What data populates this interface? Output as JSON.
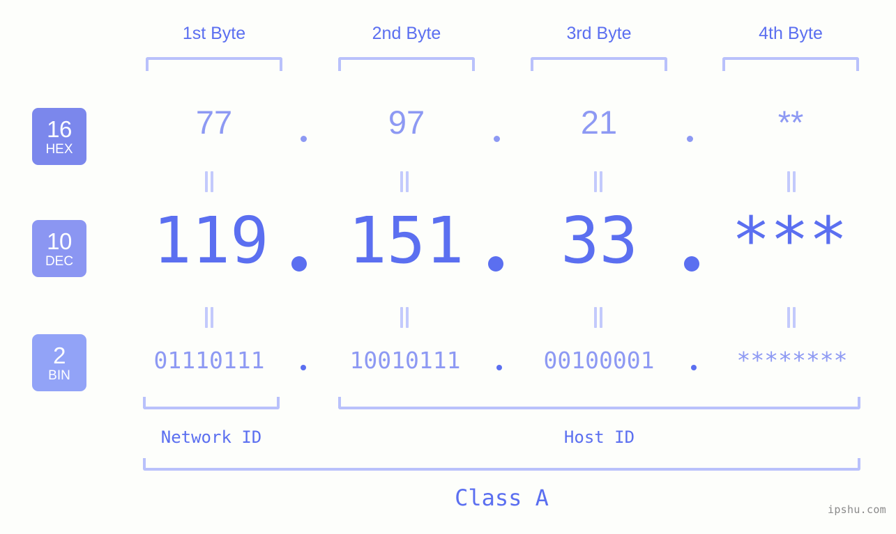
{
  "background_color": "#fdfefb",
  "accent_colors": {
    "strong": "#5b6ff0",
    "mid": "#8d99f3",
    "light": "#b9c1fb",
    "badge_hex": "#7b87ec",
    "badge_dec": "#8b96f2",
    "badge_bin": "#92a3f7",
    "watermark": "#8a8a8a"
  },
  "byte_headers": [
    {
      "label": "1st Byte"
    },
    {
      "label": "2nd Byte"
    },
    {
      "label": "3rd Byte"
    },
    {
      "label": "4th Byte"
    }
  ],
  "rows": [
    {
      "badge_number": "16",
      "badge_base": "HEX",
      "values": [
        "77",
        "97",
        "21",
        "**"
      ],
      "separator": "."
    },
    {
      "badge_number": "10",
      "badge_base": "DEC",
      "values": [
        "119",
        "151",
        "33",
        "***"
      ],
      "separator": "."
    },
    {
      "badge_number": "2",
      "badge_base": "BIN",
      "values": [
        "01110111",
        "10010111",
        "00100001",
        "********"
      ],
      "separator": "."
    }
  ],
  "equality_symbol": "=",
  "id_sections": [
    {
      "label": "Network ID"
    },
    {
      "label": "Host ID"
    }
  ],
  "class_label": "Class A",
  "watermark": "ipshu.com"
}
